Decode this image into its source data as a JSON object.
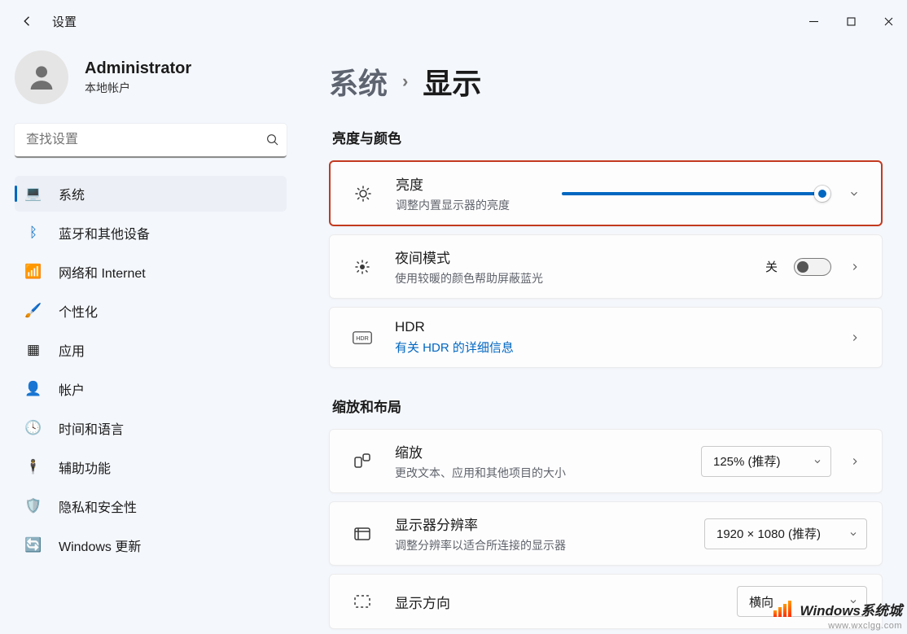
{
  "window": {
    "app_title": "设置"
  },
  "user": {
    "name": "Administrator",
    "subtitle": "本地帐户"
  },
  "search": {
    "placeholder": "查找设置"
  },
  "nav": {
    "items": [
      {
        "label": "系统",
        "icon": "💻",
        "active": true
      },
      {
        "label": "蓝牙和其他设备",
        "icon": "ᛒ",
        "active": false,
        "color": "#0067c0"
      },
      {
        "label": "网络和 Internet",
        "icon": "📶",
        "active": false
      },
      {
        "label": "个性化",
        "icon": "🖌️",
        "active": false
      },
      {
        "label": "应用",
        "icon": "▦",
        "active": false
      },
      {
        "label": "帐户",
        "icon": "👤",
        "active": false
      },
      {
        "label": "时间和语言",
        "icon": "🕓",
        "active": false
      },
      {
        "label": "辅助功能",
        "icon": "🕴",
        "active": false,
        "color": "#0067c0"
      },
      {
        "label": "隐私和安全性",
        "icon": "🛡️",
        "active": false
      },
      {
        "label": "Windows 更新",
        "icon": "🔄",
        "active": false,
        "color": "#0067c0"
      }
    ]
  },
  "breadcrumb": {
    "parent": "系统",
    "current": "显示"
  },
  "sections": {
    "brightness_color": {
      "heading": "亮度与颜色",
      "brightness": {
        "title": "亮度",
        "subtitle": "调整内置显示器的亮度",
        "value_percent": 100
      },
      "night_light": {
        "title": "夜间模式",
        "subtitle": "使用较暖的颜色帮助屏蔽蓝光",
        "state_label": "关",
        "on": false
      },
      "hdr": {
        "title": "HDR",
        "link_text": "有关 HDR 的详细信息"
      }
    },
    "scale_layout": {
      "heading": "缩放和布局",
      "scale": {
        "title": "缩放",
        "subtitle": "更改文本、应用和其他项目的大小",
        "selected": "125% (推荐)"
      },
      "resolution": {
        "title": "显示器分辨率",
        "subtitle": "调整分辨率以适合所连接的显示器",
        "selected": "1920 × 1080 (推荐)"
      },
      "orientation": {
        "title": "显示方向",
        "selected": "横向"
      }
    }
  },
  "watermark": {
    "line1": "Windows系统城",
    "line2": "www.wxclgg.com"
  }
}
